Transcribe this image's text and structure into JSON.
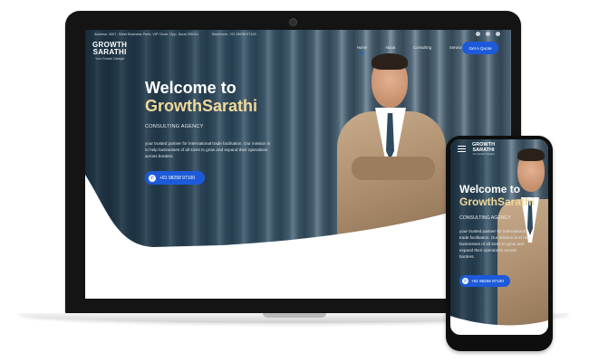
{
  "laptop": {
    "topbar": {
      "address": "Address: 3067, Silver Business Point, VIP Circle, Opp. Surat 395101",
      "telephone": "Telephone: +91 98258 97100"
    },
    "brand": {
      "line1": "GROWTH",
      "line2": "SARATHI",
      "tagline": "Your Growth Catalyst"
    },
    "nav": {
      "items": [
        {
          "label": "Home"
        },
        {
          "label": "About"
        },
        {
          "label": "Consulting"
        },
        {
          "label": "Services"
        }
      ],
      "cta_label": "Get A Quote"
    },
    "hero": {
      "title_line1": "Welcome to",
      "title_line2": "GrowthSarathi",
      "subtitle": "CONSULTING AGENCY",
      "description": "your trusted partner for international trade facilitation. Our mission is to help businesses of all sizes to grow and expand their operations across borders.",
      "phone_button": "+91 98258 97100"
    }
  },
  "phone": {
    "brand": {
      "line1": "GROWTH",
      "line2": "SARATHI",
      "tagline": "Your Growth Catalyst"
    },
    "hero": {
      "title_line1": "Welcome to",
      "title_line2": "GrowthSarathi",
      "subtitle": "CONSULTING AGENCY",
      "description": "your trusted partner for international trade facilitation. Our mission is to help businesses of all sizes to grow and expand their operations across borders.",
      "phone_button": "+91 98258 97100"
    }
  },
  "colors": {
    "accent_blue": "#1d5ad9",
    "title_gold": "#f0d89a",
    "device_black": "#141414"
  },
  "icons": {
    "phone_icon": "phone-icon",
    "menu_icon": "hamburger-menu-icon",
    "camera": "camera-icon"
  }
}
